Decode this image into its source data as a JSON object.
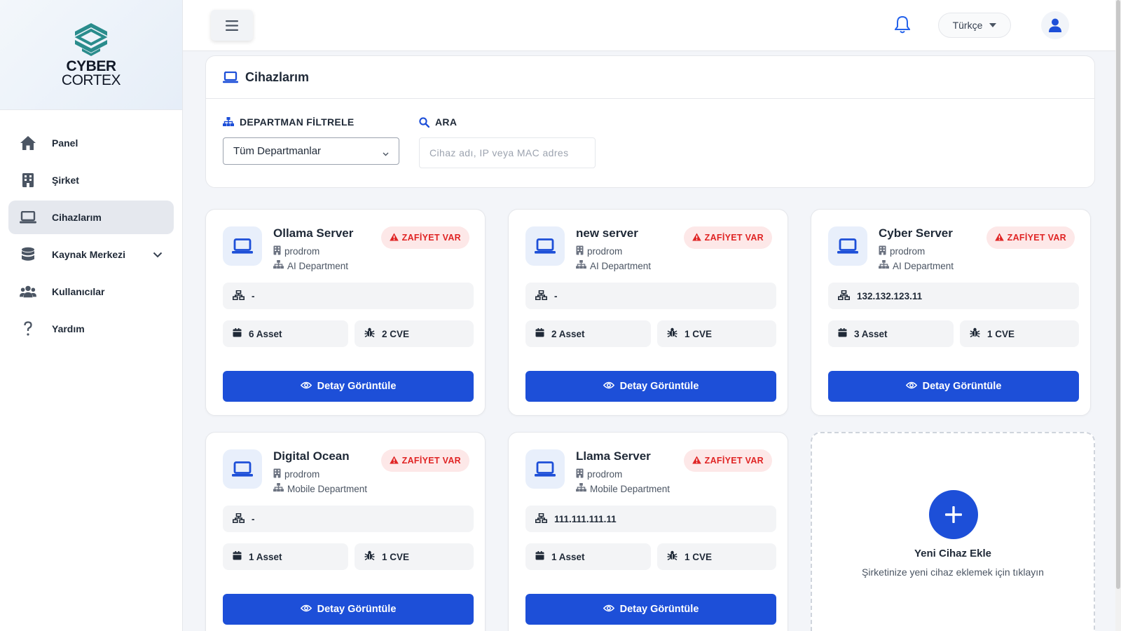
{
  "brand": {
    "line1": "CYBER",
    "line2": "CORTEX"
  },
  "sidebar": {
    "items": [
      {
        "label": "Panel",
        "icon": "home-icon"
      },
      {
        "label": "Şirket",
        "icon": "building-icon"
      },
      {
        "label": "Cihazlarım",
        "icon": "laptop-icon",
        "active": true
      },
      {
        "label": "Kaynak Merkezi",
        "icon": "database-icon",
        "has_submenu": true
      },
      {
        "label": "Kullanıcılar",
        "icon": "users-icon"
      },
      {
        "label": "Yardım",
        "icon": "question-icon"
      }
    ]
  },
  "topbar": {
    "language": "Türkçe"
  },
  "page": {
    "title": "Cihazlarım"
  },
  "filters": {
    "department_label": "DEPARTMAN FİLTRELE",
    "department_value": "Tüm Departmanlar",
    "search_label": "ARA",
    "search_placeholder": "Cihaz adı, IP veya MAC adres"
  },
  "devices": [
    {
      "name": "Ollama Server",
      "company": "prodrom",
      "department": "AI Department",
      "badge": "ZAFİYET VAR",
      "ip": "-",
      "assets": "6 Asset",
      "cves": "2 CVE",
      "action": "Detay Görüntüle"
    },
    {
      "name": "new server",
      "company": "prodrom",
      "department": "AI Department",
      "badge": "ZAFİYET VAR",
      "ip": "-",
      "assets": "2 Asset",
      "cves": "1 CVE",
      "action": "Detay Görüntüle"
    },
    {
      "name": "Cyber Server",
      "company": "prodrom",
      "department": "AI Department",
      "badge": "ZAFİYET VAR",
      "ip": "132.132.123.11",
      "assets": "3 Asset",
      "cves": "1 CVE",
      "action": "Detay Görüntüle"
    },
    {
      "name": "Digital Ocean",
      "company": "prodrom",
      "department": "Mobile Department",
      "badge": "ZAFİYET VAR",
      "ip": "-",
      "assets": "1 Asset",
      "cves": "1 CVE",
      "action": "Detay Görüntüle"
    },
    {
      "name": "Llama Server",
      "company": "prodrom",
      "department": "Mobile Department",
      "badge": "ZAFİYET VAR",
      "ip": "111.111.111.11",
      "assets": "1 Asset",
      "cves": "1 CVE",
      "action": "Detay Görüntüle"
    }
  ],
  "add_device": {
    "title": "Yeni Cihaz Ekle",
    "subtitle": "Şirketinize yeni cihaz eklemek için tıklayın"
  },
  "colors": {
    "primary": "#1d4fd8",
    "danger": "#e02424",
    "danger_bg": "#fde8e8",
    "icon_bg": "#e8effb",
    "teal": "#2a8c8c"
  }
}
